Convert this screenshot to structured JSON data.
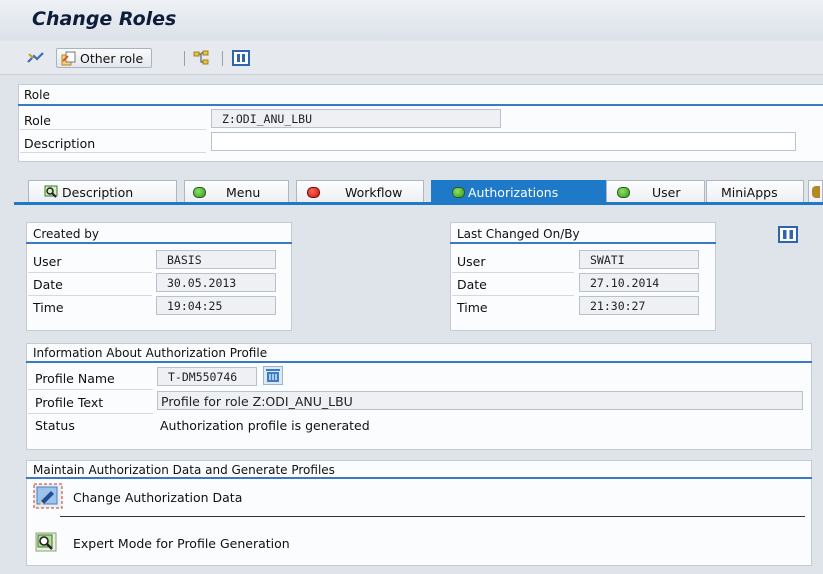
{
  "window": {
    "title": "Change Roles"
  },
  "toolbar": {
    "other_role_label": "Other role"
  },
  "role_block": {
    "header": "Role",
    "role_label": "Role",
    "role_value": "Z:ODI_ANU_LBU",
    "description_label": "Description",
    "description_value": ""
  },
  "tabs": [
    {
      "label": "Description",
      "status": "none"
    },
    {
      "label": "Menu",
      "status": "green"
    },
    {
      "label": "Workflow",
      "status": "red"
    },
    {
      "label": "Authorizations",
      "status": "green",
      "active": true
    },
    {
      "label": "User",
      "status": "green"
    },
    {
      "label": "MiniApps",
      "status": "none"
    }
  ],
  "created_by": {
    "header": "Created by",
    "user_label": "User",
    "user_value": "BASIS",
    "date_label": "Date",
    "date_value": "30.05.2013",
    "time_label": "Time",
    "time_value": "19:04:25"
  },
  "last_changed": {
    "header": "Last Changed On/By",
    "user_label": "User",
    "user_value": "SWATI",
    "date_label": "Date",
    "date_value": "27.10.2014",
    "time_label": "Time",
    "time_value": "21:30:27"
  },
  "profile_info": {
    "header": "Information About Authorization Profile",
    "profile_name_label": "Profile Name",
    "profile_name_value": "T-DM550746",
    "profile_text_label": "Profile Text",
    "profile_text_value": "Profile for role Z:ODI_ANU_LBU",
    "status_label": "Status",
    "status_value": "Authorization profile is generated"
  },
  "maintain": {
    "header": "Maintain Authorization Data and Generate Profiles",
    "change_label": "Change Authorization Data",
    "expert_label": "Expert Mode for Profile Generation"
  },
  "colors": {
    "accent": "#1e79c8",
    "led_green": "#2f9a1a",
    "led_red": "#c8120a"
  },
  "icons": [
    "display-change-icon",
    "other-role-icon",
    "hierarchy-icon",
    "info-icon",
    "delete-icon",
    "pencil-icon",
    "expert-icon"
  ]
}
